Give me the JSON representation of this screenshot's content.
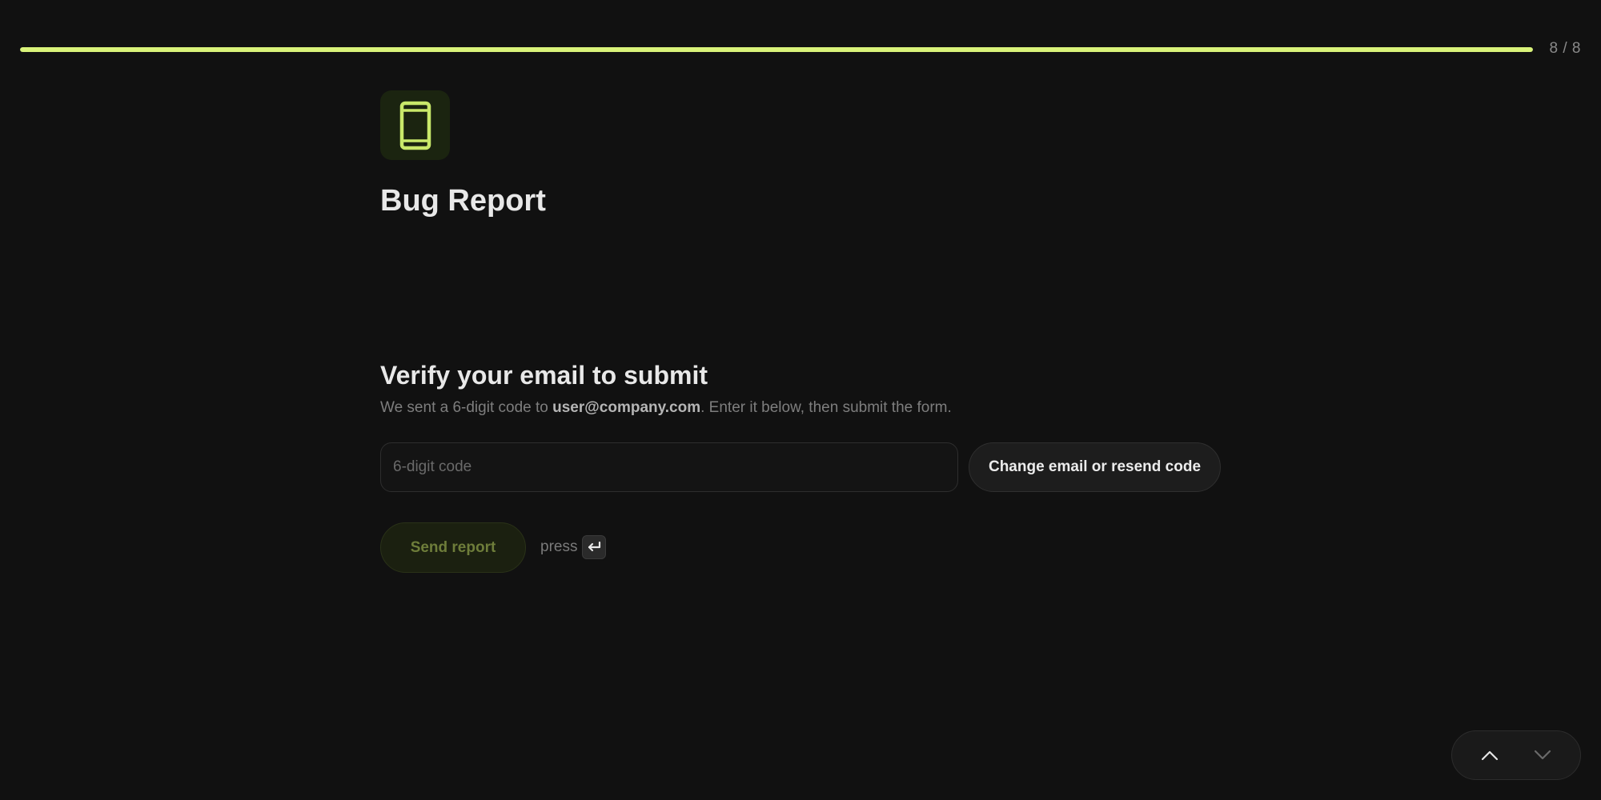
{
  "progress": {
    "count_label": "8 / 8",
    "fraction": 1.0,
    "color": "#d9f37a"
  },
  "header": {
    "icon": "smartphone-icon",
    "title": "Bug Report"
  },
  "verify": {
    "title": "Verify your email to submit",
    "desc_prefix": "We sent a 6-digit code to ",
    "email": "user@company.com",
    "desc_suffix": ". Enter it below, then submit the form.",
    "code_input": {
      "placeholder": "6-digit code",
      "value": ""
    },
    "resend_label": "Change email or resend code"
  },
  "submit": {
    "send_label": "Send report",
    "press_label": "press",
    "enter_icon": "enter-key-icon"
  },
  "nav": {
    "up_icon": "chevron-up-icon",
    "down_icon": "chevron-down-icon"
  },
  "colors": {
    "accent": "#d9f37a",
    "background": "#111111"
  }
}
